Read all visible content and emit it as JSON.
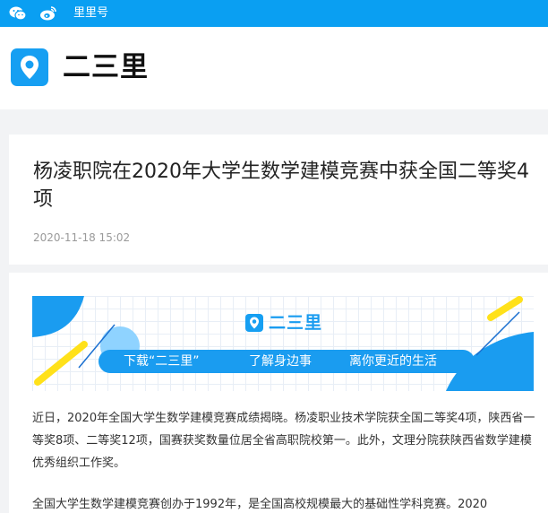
{
  "topbar": {
    "icons": [
      "wechat-icon",
      "weibo-icon"
    ],
    "link_label": "里里号",
    "color": "#0a9ff2"
  },
  "header": {
    "brand": "二三里",
    "logo_icon": "location-pin-icon",
    "logo_color": "#169ff2"
  },
  "article": {
    "title": "杨凌职院在2020年大学生数学建模竞赛中获全国二等奖4项",
    "date": "2020-11-18 15:02",
    "banner": {
      "brand": "二三里",
      "slogans": [
        "下载“二三里”",
        "了解身边事",
        "离你更近的生活"
      ]
    },
    "paragraphs": [
      "近日，2020年全国大学生数学建模竞赛成绩揭晓。杨凌职业技术学院获全国二等奖4项，陕西省一等奖8项、二等奖12项，国赛获奖数量位居全省高职院校第一。此外，文理分院获陕西省数学建模优秀组织工作奖。",
      "全国大学生数学建模竞赛创办于1992年，是全国高校规模最大的基础性学科竞赛。2020"
    ]
  }
}
